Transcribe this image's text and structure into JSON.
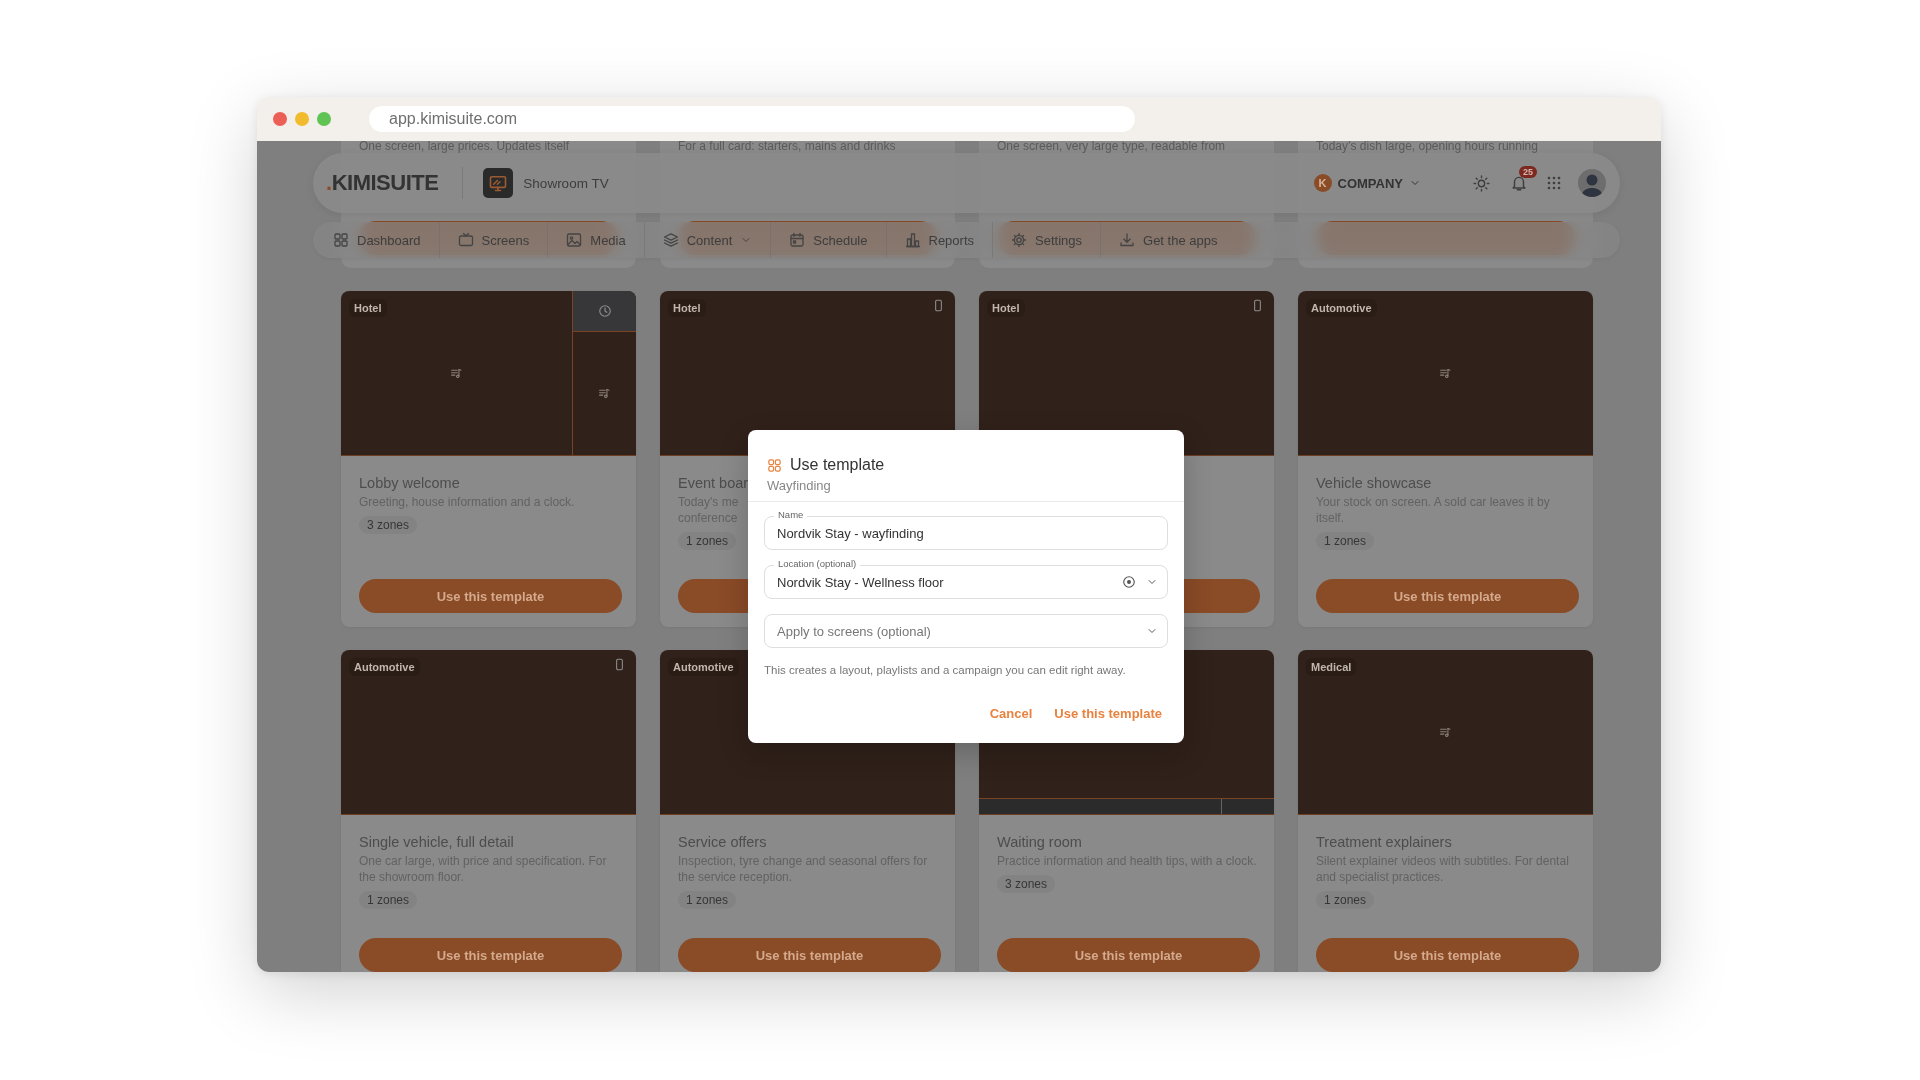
{
  "browser": {
    "url": "app.kimisuite.com"
  },
  "header": {
    "logo_mark": ".",
    "logo": "KIMISUITE",
    "screen": "Showroom TV",
    "company_initial": "K",
    "company": "COMPANY",
    "notifications": "25"
  },
  "nav": [
    {
      "kind": "dashboard",
      "label": "Dashboard",
      "has_menu": false
    },
    {
      "kind": "screens",
      "label": "Screens",
      "has_menu": false
    },
    {
      "kind": "media",
      "label": "Media",
      "has_menu": false
    },
    {
      "kind": "content",
      "label": "Content",
      "has_menu": true
    },
    {
      "kind": "schedule",
      "label": "Schedule",
      "has_menu": false
    },
    {
      "kind": "reports",
      "label": "Reports",
      "has_menu": false
    },
    {
      "kind": "settings",
      "label": "Settings",
      "has_menu": false
    },
    {
      "kind": "apps",
      "label": "Get the apps",
      "has_menu": false
    }
  ],
  "cards_above": [
    {
      "description": "One screen, large prices. Updates itself"
    },
    {
      "description": "For a full card: starters, mains and drinks"
    },
    {
      "description": "One screen, very large type, readable from"
    },
    {
      "description": "Today’s dish large, opening hours running"
    }
  ],
  "cards": [
    {
      "category": "Hotel",
      "kind": "split",
      "clock_icon": true,
      "phone_icon": false,
      "center_icon": true,
      "title": "Lobby welcome",
      "description": "Greeting, house information and a clock.",
      "zones": "3 zones",
      "button": "Use this template"
    },
    {
      "category": "Hotel",
      "kind": "single",
      "clock_icon": false,
      "phone_icon": true,
      "center_icon": false,
      "title": "Event boar",
      "description": "Today's me\nconference",
      "zones": "1 zones"
    },
    {
      "category": "Hotel",
      "kind": "single",
      "clock_icon": false,
      "phone_icon": true,
      "center_icon": false
    },
    {
      "category": "Automotive",
      "kind": "single",
      "clock_icon": false,
      "phone_icon": false,
      "center_icon": true,
      "title": "Vehicle showcase",
      "description": "Your stock on screen. A sold car leaves it by itself.",
      "zones": "1 zones",
      "button": "Use this template"
    },
    {
      "category": "Automotive",
      "kind": "single",
      "clock_icon": false,
      "phone_icon": true,
      "center_icon": false,
      "title": "Single vehicle, full detail",
      "description": "One car large, with price and specification. For the showroom floor.",
      "zones": "1 zones",
      "button": "Use this template"
    },
    {
      "category": "Automotive",
      "kind": "single",
      "clock_icon": false,
      "phone_icon": false,
      "center_icon": false,
      "title": "Service offers",
      "description": "Inspection, tyre change and seasonal offers for the service reception.",
      "zones": "1 zones",
      "button": "Use this template"
    },
    {
      "kind": "ticker",
      "clock_icon": false,
      "phone_icon": false,
      "center_icon": false,
      "title": "Waiting room",
      "description": "Practice information and health tips, with a clock.",
      "zones": "3 zones",
      "button": "Use this template"
    },
    {
      "category": "Medical",
      "kind": "single",
      "clock_icon": false,
      "phone_icon": false,
      "center_icon": true,
      "title": "Treatment explainers",
      "description": "Silent explainer videos with subtitles. For dental and specialist practices.",
      "zones": "1 zones",
      "button": "Use this template"
    }
  ],
  "dialog": {
    "title": "Use template",
    "subtitle": "Wayfinding",
    "fields": [
      {
        "kind": "text",
        "label": "Name",
        "value": "Nordvik Stay - wayfinding",
        "clearable": false
      },
      {
        "kind": "select",
        "label": "Location (optional)",
        "value": "Nordvik Stay - Wellness floor",
        "clearable": true
      },
      {
        "kind": "select",
        "placeholder": "Apply to screens (optional)",
        "clearable": false
      }
    ],
    "note": "This creates a layout, playlists and a campaign you can edit right away.",
    "actions": [
      "Cancel",
      "Use this template"
    ]
  }
}
